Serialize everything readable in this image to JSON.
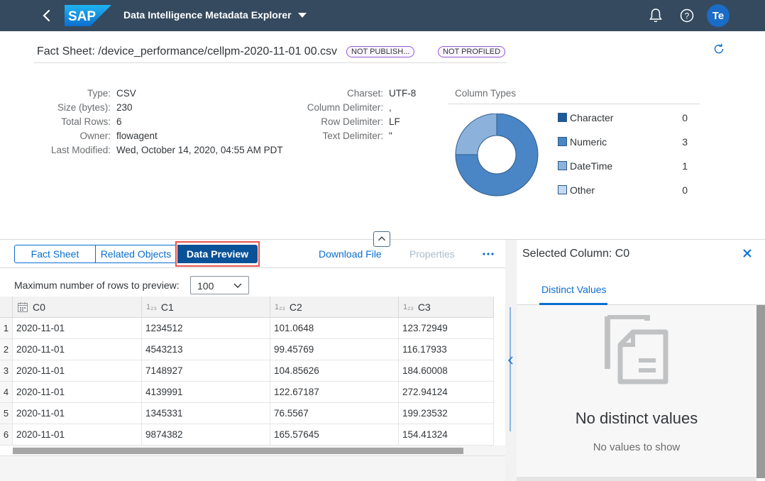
{
  "shell": {
    "logo_text": "SAP",
    "app_title": "Data Intelligence Metadata Explorer",
    "user_initials": "Te"
  },
  "fact_sheet": {
    "title": "Fact Sheet: /device_performance/cellpm-2020-11-01 00.csv",
    "badges": [
      "NOT PUBLISH...",
      "NOT PROFILED"
    ],
    "properties_left": [
      {
        "label": "Type:",
        "value": "CSV"
      },
      {
        "label": "Size (bytes):",
        "value": "230"
      },
      {
        "label": "Total Rows:",
        "value": "6"
      },
      {
        "label": "Owner:",
        "value": "flowagent"
      },
      {
        "label": "Last Modified:",
        "value": "Wed, October 14, 2020, 04:55 AM PDT"
      }
    ],
    "properties_right": [
      {
        "label": "Charset:",
        "value": "UTF-8"
      },
      {
        "label": "Column Delimiter:",
        "value": ","
      },
      {
        "label": "Row Delimiter:",
        "value": "LF"
      },
      {
        "label": "Text Delimiter:",
        "value": "\""
      }
    ]
  },
  "column_types": {
    "title": "Column Types",
    "items": [
      {
        "name": "Character",
        "count": "0",
        "color": "#1d5a9c"
      },
      {
        "name": "Numeric",
        "count": "3",
        "color": "#4a86c5"
      },
      {
        "name": "DateTime",
        "count": "1",
        "color": "#8cb2dc"
      },
      {
        "name": "Other",
        "count": "0",
        "color": "#c4d8ef"
      }
    ]
  },
  "tabs": {
    "fact_sheet": "Fact Sheet",
    "related_objects": "Related Objects",
    "data_preview": "Data Preview",
    "download_file": "Download File",
    "properties": "Properties"
  },
  "preview": {
    "max_rows_label": "Maximum number of rows to preview:",
    "max_rows_value": "100",
    "columns": [
      {
        "name": "C0",
        "type_icon": "calendar-icon"
      },
      {
        "name": "C1",
        "type_icon": "numeric-icon",
        "icon_text": "1₂₃"
      },
      {
        "name": "C2",
        "type_icon": "numeric-icon",
        "icon_text": "1₂₃"
      },
      {
        "name": "C3",
        "type_icon": "numeric-icon",
        "icon_text": "1₂₃"
      }
    ],
    "rows": [
      {
        "n": "1",
        "c": [
          "2020-11-01",
          "1234512",
          "101.0648",
          "123.72949"
        ]
      },
      {
        "n": "2",
        "c": [
          "2020-11-01",
          "4543213",
          "99.45769",
          "116.17933"
        ]
      },
      {
        "n": "3",
        "c": [
          "2020-11-01",
          "7148927",
          "104.85626",
          "184.60008"
        ]
      },
      {
        "n": "4",
        "c": [
          "2020-11-01",
          "4139991",
          "122.67187",
          "272.94124"
        ]
      },
      {
        "n": "5",
        "c": [
          "2020-11-01",
          "1345331",
          "76.5567",
          "199.23532"
        ]
      },
      {
        "n": "6",
        "c": [
          "2020-11-01",
          "9874382",
          "165.57645",
          "154.41324"
        ]
      }
    ]
  },
  "side_panel": {
    "title": "Selected Column: C0",
    "tab": "Distinct Values",
    "empty_title": "No distinct values",
    "empty_subtitle": "No values to show"
  }
}
